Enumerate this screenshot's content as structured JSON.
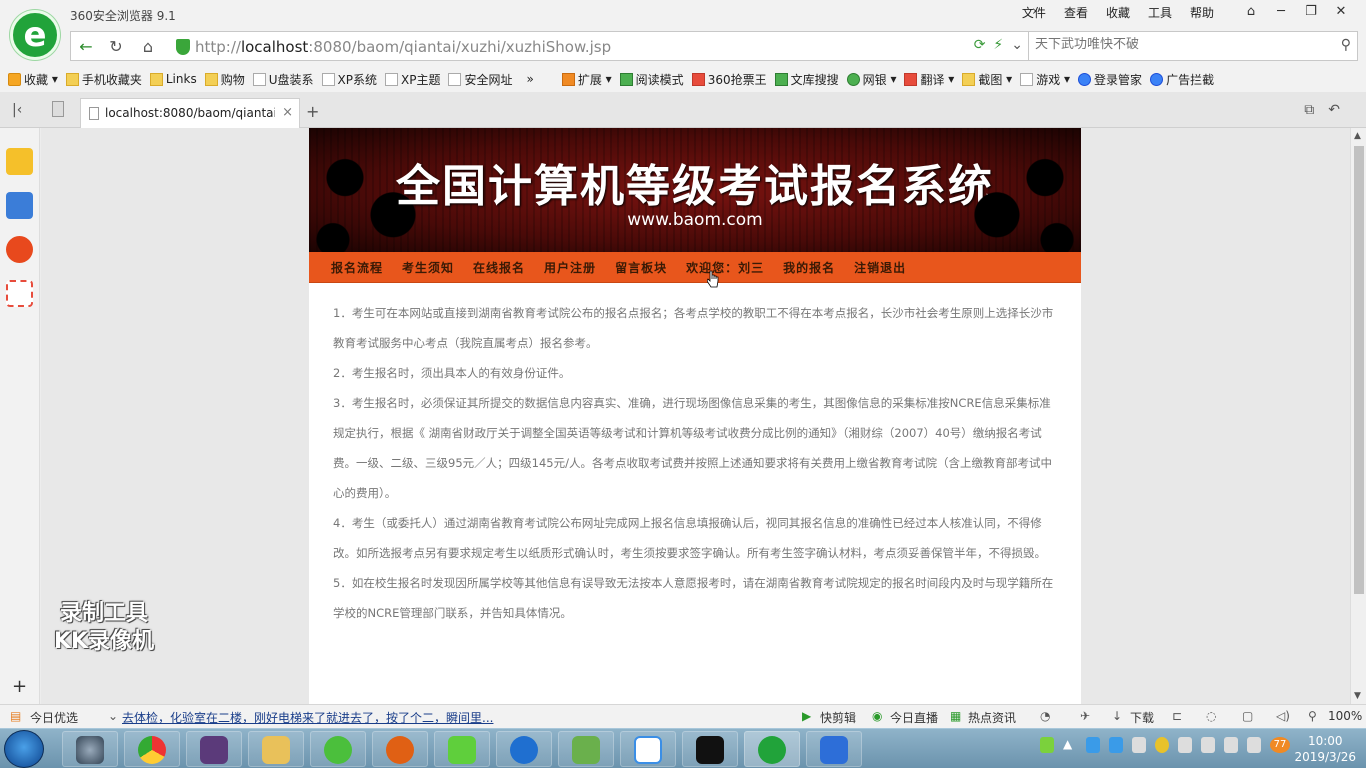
{
  "browser": {
    "app_title": "360安全浏览器 9.1",
    "menu": [
      "文件",
      "查看",
      "收藏",
      "工具",
      "帮助"
    ],
    "window_controls": [
      "皮肤",
      "最小化",
      "最大化",
      "关闭"
    ],
    "url_host": "localhost",
    "url_prefix": "http://",
    "url_suffix": ":8080/baom/qiantai/xuzhi/xuzhiShow.jsp",
    "search_placeholder": "天下武功唯快不破"
  },
  "bookmarks": [
    {
      "label": "收藏",
      "icon": "star-icon"
    },
    {
      "label": "手机收藏夹",
      "icon": "folder-icon"
    },
    {
      "label": "Links",
      "icon": "folder-icon"
    },
    {
      "label": "购物",
      "icon": "folder-icon"
    },
    {
      "label": "U盘装系",
      "icon": "page-icon"
    },
    {
      "label": "XP系统",
      "icon": "page-icon"
    },
    {
      "label": "XP主题",
      "icon": "page-icon"
    },
    {
      "label": "安全网址",
      "icon": "page-icon"
    },
    {
      "label": "扩展",
      "icon": "grid-icon"
    },
    {
      "label": "阅读模式",
      "icon": "book-icon"
    },
    {
      "label": "360抢票王",
      "icon": "ticket-icon"
    },
    {
      "label": "文库搜搜",
      "icon": "doc-icon"
    },
    {
      "label": "网银",
      "icon": "bank-icon"
    },
    {
      "label": "翻译",
      "icon": "translate-icon"
    },
    {
      "label": "截图",
      "icon": "scissors-icon"
    },
    {
      "label": "游戏",
      "icon": "game-icon"
    },
    {
      "label": "登录管家",
      "icon": "key-icon"
    },
    {
      "label": "广告拦截",
      "icon": "block-icon"
    }
  ],
  "tab": {
    "title": "localhost:8080/baom/qiantai/"
  },
  "page": {
    "banner_title": "全国计算机等级考试报名系统",
    "banner_sub": "www.baom.com",
    "nav": [
      "报名流程",
      "考生须知",
      "在线报名",
      "用户注册",
      "留言板块",
      "欢迎您：刘三",
      "我的报名",
      "注销退出"
    ],
    "paragraphs": [
      "1．考生可在本网站或直接到湖南省教育考试院公布的报名点报名；各考点学校的教职工不得在本考点报名，长沙市社会考生原则上选择长沙市教育考试服务中心考点（我院直属考点）报名参考。",
      "2．考生报名时，须出具本人的有效身份证件。",
      "3．考生报名时，必须保证其所提交的数据信息内容真实、准确，进行现场图像信息采集的考生，其图像信息的采集标准按NCRE信息采集标准规定执行，根据《 湖南省财政厅关于调整全国英语等级考试和计算机等级考试收费分成比例的通知》（湘财综（2007）40号）缴纳报名考试费。一级、二级、三级95元／人；四级145元/人。各考点收取考试费并按照上述通知要求将有关费用上缴省教育考试院（含上缴教育部考试中心的费用）。",
      "4．考生（或委托人）通过湖南省教育考试院公布网址完成网上报名信息填报确认后，视同其报名信息的准确性已经过本人核准认同，不得修改。如所选报考点另有要求规定考生以纸质形式确认时，考生须按要求签字确认。所有考生签字确认材料，考点须妥善保管半年，不得损毁。",
      "5．如在校生报名时发现因所属学校等其他信息有误导致无法按本人意愿报考时，请在湖南省教育考试院规定的报名时间段内及时与现学籍所在学校的NCRE管理部门联系，并告知具体情况。"
    ]
  },
  "watermark": {
    "line1": "录制工具",
    "line2": "KK录像机"
  },
  "statusbar": {
    "today": "今日优选",
    "news": "去体检，化验室在二楼，刚好电梯来了就进去了，按了个二，瞬间里...",
    "items": [
      "快剪辑",
      "今日直播",
      "热点资讯",
      "下载"
    ],
    "zoom": "100%"
  },
  "taskbar": {
    "time": "10:00",
    "date": "2019/3/26",
    "badge": "77"
  },
  "colors": {
    "nav_bg": "#e8561c",
    "banner_bg": "#5a0c09",
    "accent_green": "#21a33a"
  }
}
